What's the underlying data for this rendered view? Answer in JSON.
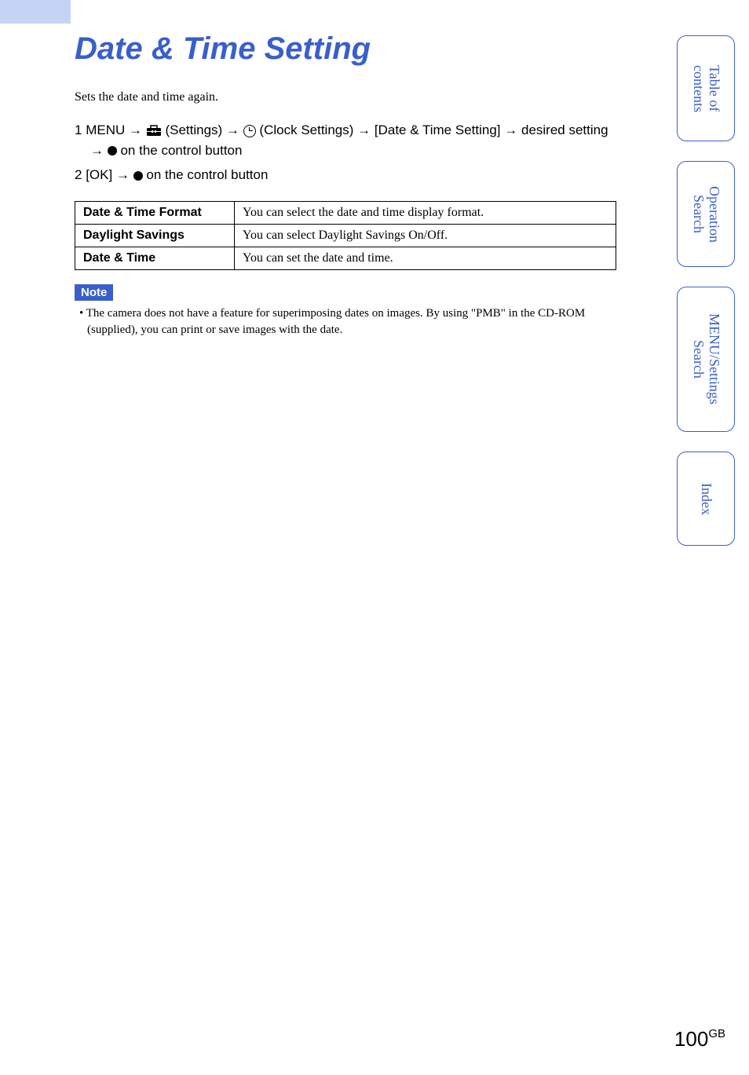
{
  "page_title": "Date & Time Setting",
  "intro": "Sets the date and time again.",
  "steps": {
    "step1": {
      "num": "1",
      "menu": "MENU",
      "settings": "(Settings)",
      "clock_settings": "(Clock Settings)",
      "date_time_setting": "[Date & Time Setting]",
      "desired": "desired setting",
      "control": "on the control button"
    },
    "step2": {
      "num": "2",
      "ok": "[OK]",
      "control": "on the control button"
    }
  },
  "table": {
    "rows": [
      {
        "label": "Date & Time Format",
        "desc": "You can select the date and time display format."
      },
      {
        "label": "Daylight Savings",
        "desc": "You can select Daylight Savings On/Off."
      },
      {
        "label": "Date & Time",
        "desc": "You can set the date and time."
      }
    ]
  },
  "note": {
    "label": "Note",
    "text": "The camera does not have a feature for superimposing dates on images. By using \"PMB\" in the CD-ROM (supplied), you can print or save images with the date."
  },
  "side_tabs": {
    "toc": "Table of contents",
    "operation": "Operation Search",
    "menu": "MENU/Settings Search",
    "index": "Index"
  },
  "page_number": {
    "num": "100",
    "suffix": "GB"
  }
}
